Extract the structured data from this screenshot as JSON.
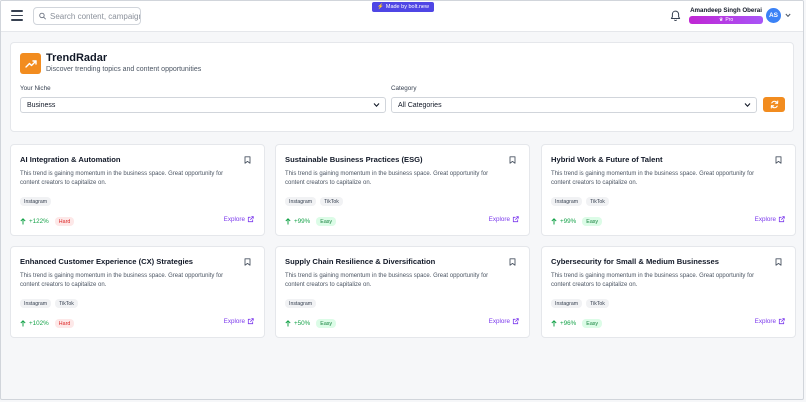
{
  "topbar": {
    "search_placeholder": "Search content, campaign",
    "made_by": "Made by bolt.new",
    "user_name": "Amandeep Singh Oberai",
    "plan": "Pro",
    "avatar_initials": "AS"
  },
  "header": {
    "title": "TrendRadar",
    "subtitle": "Discover trending topics and content opportunities",
    "niche_label": "Your Niche",
    "niche_value": "Business",
    "category_label": "Category",
    "category_value": "All Categories"
  },
  "colors": {
    "accent": "#f28c1f",
    "growth": "#16a34a",
    "explore": "#7c3aed",
    "pro_gradient": "#c026d3"
  },
  "cards": [
    {
      "title": "AI Integration & Automation",
      "desc": "This trend is gaining momentum in the business space. Great opportunity for content creators to capitalize on.",
      "tags": [
        "Instagram"
      ],
      "growth": "+122%",
      "difficulty": "Hard",
      "explore": "Explore"
    },
    {
      "title": "Sustainable Business Practices (ESG)",
      "desc": "This trend is gaining momentum in the business space. Great opportunity for content creators to capitalize on.",
      "tags": [
        "Instagram",
        "TikTok"
      ],
      "growth": "+99%",
      "difficulty": "Easy",
      "explore": "Explore"
    },
    {
      "title": "Hybrid Work & Future of Talent",
      "desc": "This trend is gaining momentum in the business space. Great opportunity for content creators to capitalize on.",
      "tags": [
        "Instagram",
        "TikTok"
      ],
      "growth": "+99%",
      "difficulty": "Easy",
      "explore": "Explore"
    },
    {
      "title": "Enhanced Customer Experience (CX) Strategies",
      "desc": "This trend is gaining momentum in the business space. Great opportunity for content creators to capitalize on.",
      "tags": [
        "Instagram",
        "TikTok"
      ],
      "growth": "+102%",
      "difficulty": "Hard",
      "explore": "Explore"
    },
    {
      "title": "Supply Chain Resilience & Diversification",
      "desc": "This trend is gaining momentum in the business space. Great opportunity for content creators to capitalize on.",
      "tags": [
        "Instagram"
      ],
      "growth": "+50%",
      "difficulty": "Easy",
      "explore": "Explore"
    },
    {
      "title": "Cybersecurity for Small & Medium Businesses",
      "desc": "This trend is gaining momentum in the business space. Great opportunity for content creators to capitalize on.",
      "tags": [
        "Instagram",
        "TikTok"
      ],
      "growth": "+96%",
      "difficulty": "Easy",
      "explore": "Explore"
    }
  ]
}
